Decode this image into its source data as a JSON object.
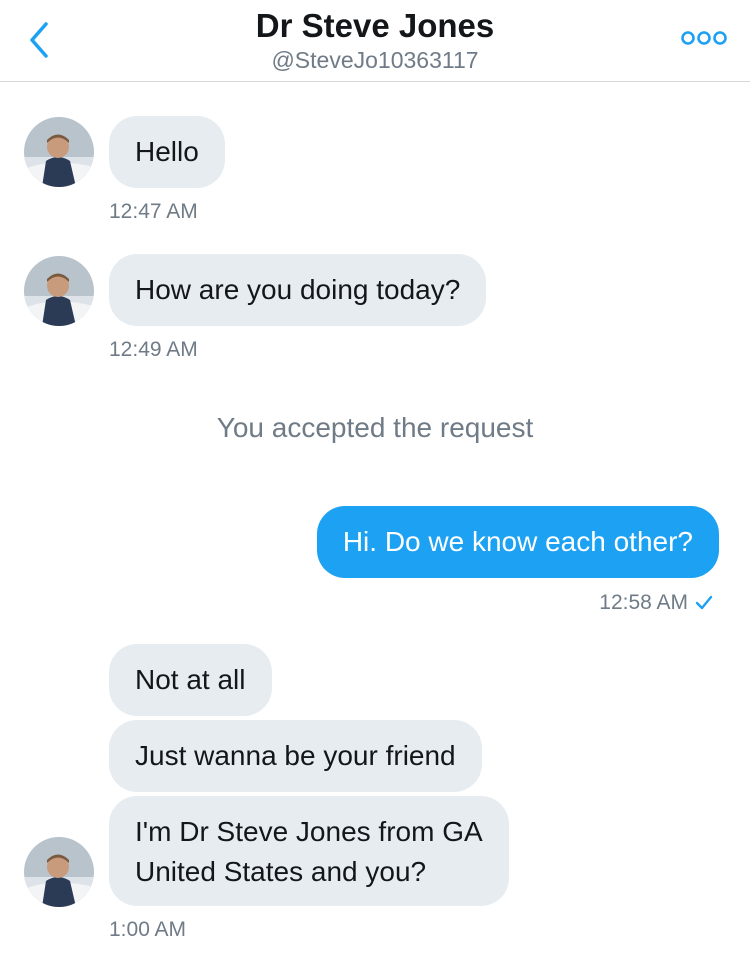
{
  "header": {
    "title": "Dr Steve Jones",
    "handle": "@SteveJo10363117"
  },
  "icons": {
    "back": "chevron-left-icon",
    "more": "more-options-icon",
    "read": "checkmark-icon"
  },
  "colors": {
    "accent": "#1da1f2",
    "incoming_bubble": "#e6ecf0",
    "secondary_text": "#6f7b86"
  },
  "messages": [
    {
      "text": "Hello",
      "time": "12:47 AM"
    },
    {
      "text": "How are you doing today?",
      "time": "12:49 AM"
    },
    {
      "system": "You accepted the request"
    },
    {
      "text": "Hi. Do we know each other?",
      "time": "12:58 AM"
    },
    {
      "text": "Not at all"
    },
    {
      "text": "Just wanna be your friend"
    },
    {
      "lines": [
        "I'm Dr Steve Jones from GA",
        "United States and you?"
      ],
      "time": "1:00 AM"
    }
  ]
}
